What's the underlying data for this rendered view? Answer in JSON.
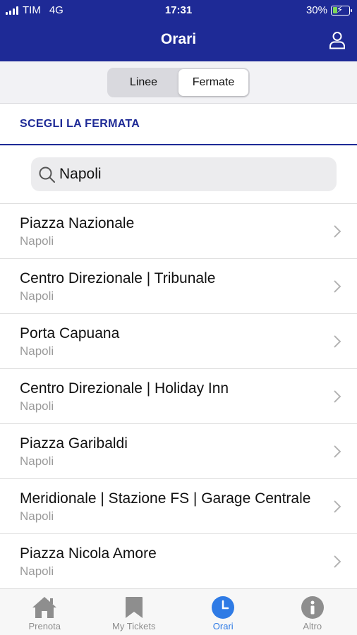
{
  "status_bar": {
    "carrier": "TIM",
    "network": "4G",
    "time": "17:31",
    "battery": "30%",
    "battery_level": 0.3
  },
  "header": {
    "title": "Orari",
    "profile_icon": "person-icon"
  },
  "segments": {
    "items": [
      "Linee",
      "Fermate"
    ],
    "selected": "Fermate"
  },
  "section": {
    "title": "SCEGLI LA FERMATA"
  },
  "search": {
    "value": "Napoli",
    "icon": "search-icon"
  },
  "stops": [
    {
      "name": "Piazza Nazionale",
      "city": "Napoli"
    },
    {
      "name": "Centro Direzionale | Tribunale",
      "city": "Napoli"
    },
    {
      "name": "Porta Capuana",
      "city": "Napoli"
    },
    {
      "name": "Centro Direzionale | Holiday Inn",
      "city": "Napoli"
    },
    {
      "name": "Piazza Garibaldi",
      "city": "Napoli"
    },
    {
      "name": "Meridionale | Stazione FS | Garage Centrale",
      "city": "Napoli"
    },
    {
      "name": "Piazza Nicola Amore",
      "city": "Napoli"
    }
  ],
  "tabbar": {
    "items": [
      {
        "label": "Prenota",
        "icon": "home-icon"
      },
      {
        "label": "My Tickets",
        "icon": "bookmark-icon"
      },
      {
        "label": "Orari",
        "icon": "clock-icon"
      },
      {
        "label": "Altro",
        "icon": "info-icon"
      }
    ],
    "active": "Orari"
  },
  "colors": {
    "brand": "#1e2a96",
    "active_tab": "#2f7be5",
    "inactive_tab": "#8e8e8e",
    "battery_fill": "#7ed957"
  }
}
